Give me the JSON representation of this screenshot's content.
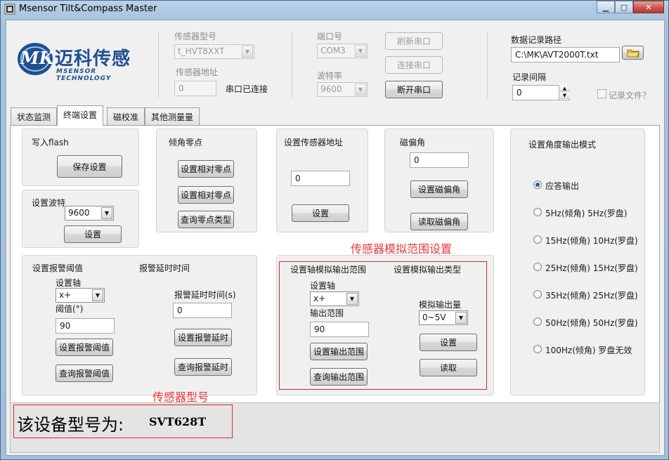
{
  "window": {
    "title": "Msensor Tilt&Compass Master",
    "min": "▁",
    "max": "□",
    "close": "✕"
  },
  "logo": {
    "badge": "MK",
    "cn": "迈科传感",
    "en": "MSENSOR TECHNOLOGY"
  },
  "sensor": {
    "model_label": "传感器型号",
    "model_value": "t_HVT8XXT",
    "addr_label": "传感器地址",
    "addr_value": "0",
    "conn_status": "串口已连接"
  },
  "port": {
    "port_label": "端口号",
    "port_value": "COM3",
    "baud_label": "波特率",
    "baud_value": "9600",
    "refresh": "刷新串口",
    "connect": "连接串口",
    "disconnect": "断开串口"
  },
  "log": {
    "path_label": "数据记录路径",
    "path_value": "C:\\MK\\AVT2000T.txt",
    "interval_label": "记录间隔",
    "interval_value": "0",
    "record_label": "记录文件？"
  },
  "tabs": [
    "状态监测",
    "终端设置",
    "磁校准",
    "其他测量量"
  ],
  "panel": {
    "flash": {
      "title": "写入flash",
      "save": "保存设置"
    },
    "baud": {
      "title": "设置波特",
      "value": "9600",
      "set": "设置"
    },
    "zero": {
      "title": "倾角零点",
      "b1": "设置相对零点",
      "b2": "设置相对零点",
      "b3": "查询零点类型"
    },
    "addr": {
      "title": "设置传感器地址",
      "value": "0",
      "set": "设置"
    },
    "decl": {
      "title": "磁偏角",
      "value": "0",
      "set": "设置磁偏角",
      "read": "读取磁偏角"
    },
    "alarm": {
      "title": "设置报警阈值",
      "axis_label": "设置轴",
      "axis_value": "x+",
      "thr_label": "阈值(°)",
      "thr_value": "90",
      "set": "设置报警阈值",
      "query": "查询报警阈值",
      "delay_title": "报警延时时间",
      "delay_label": "报警延时时间(s)",
      "delay_value": "0",
      "delay_set": "设置报警延时",
      "delay_query": "查询报警延时"
    },
    "analog": {
      "annotation": "传感器模拟范围设置",
      "title": "设置轴模拟输出范围",
      "axis_label": "设置轴",
      "axis_value": "x+",
      "range_label": "输出范围",
      "range_value": "90",
      "set": "设置输出范围",
      "query": "查询输出范围",
      "type_title": "设置模拟输出类型",
      "out_label": "模拟输出量",
      "out_value": "0~5V",
      "type_set": "设置",
      "type_read": "读取"
    },
    "mode": {
      "title": "设置角度输出模式",
      "options": [
        "应答输出",
        "5Hz(倾角)    5Hz(罗盘)",
        "15Hz(倾角) 10Hz(罗盘)",
        "25Hz(倾角) 15Hz(罗盘)",
        "35Hz(倾角) 25Hz(罗盘)",
        "50Hz(倾角) 50Hz(罗盘)",
        "100Hz(倾角) 罗盘无效"
      ],
      "selected": 0
    }
  },
  "status": {
    "annotation": "传感器型号",
    "prefix": "该设备型号为:",
    "model": "SVT628T"
  },
  "colors": {
    "annotation_red": "#e8383b",
    "logo_blue": "#1f4f8f"
  }
}
